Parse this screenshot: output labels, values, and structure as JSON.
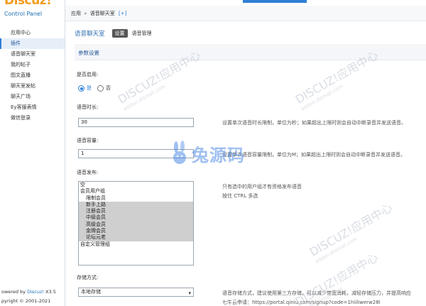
{
  "sidebar": {
    "brand": "Discuz!",
    "subtitle": "Control Panel",
    "items": [
      {
        "label": "应用中心"
      },
      {
        "label": "插件"
      },
      {
        "label": "语音聊天室"
      },
      {
        "label": "我的帖子"
      },
      {
        "label": "图文直播"
      },
      {
        "label": "聊天室发帖"
      },
      {
        "label": "聊天广场"
      },
      {
        "label": "Ey客服表情"
      },
      {
        "label": "微信登录"
      }
    ],
    "footer_line1_prefix": "owered by ",
    "footer_brand": "Discuz!",
    "footer_version": " X3.5",
    "footer_line2": "pyright © 2001-2021"
  },
  "breadcrumb": {
    "part1": "应用",
    "sep": "»",
    "part2": "语音聊天室",
    "plus": "[+]"
  },
  "header": {
    "plugin_title": "语音聊天室",
    "tab_settings": "设置",
    "tab_manage": "语音管理"
  },
  "section": {
    "title": "参数设置"
  },
  "form": {
    "enable_label": "是否启用:",
    "enable_yes": "是",
    "enable_no": "否",
    "duration_label": "语音时长:",
    "duration_value": "30",
    "duration_hint": "设置单次语音时长限制，单位为秒；如果超出上限时则会自动中断录音并发送语音。",
    "capacity_label": "语音容量:",
    "capacity_value": "1",
    "capacity_hint": "设置单次语音容量限制，单位为M；如果超出上限时则会自动中断录音并发送语音。",
    "publish_label": "语音发布:",
    "publish_hint1": "只有选中的用户组才有资格发布语音",
    "publish_hint2": "按住 CTRL 多选",
    "publish_options": [
      {
        "label": "空",
        "indent": false,
        "selected": false
      },
      {
        "label": "会员用户组",
        "indent": false,
        "selected": false
      },
      {
        "label": "限制会员",
        "indent": true,
        "selected": false
      },
      {
        "label": "新手上路",
        "indent": true,
        "selected": true
      },
      {
        "label": "注册会员",
        "indent": true,
        "selected": true
      },
      {
        "label": "中级会员",
        "indent": true,
        "selected": true
      },
      {
        "label": "高级会员",
        "indent": true,
        "selected": true
      },
      {
        "label": "金牌会员",
        "indent": true,
        "selected": true
      },
      {
        "label": "论坛元老",
        "indent": true,
        "selected": true
      },
      {
        "label": "自定义管理组",
        "indent": false,
        "selected": false
      }
    ],
    "storage_label": "存储方式:",
    "storage_value": "本地存储",
    "storage_hint1": "语音存储方式，建议使用第三方存储，可以减少带宽消耗，减轻存储压力，并提高响应",
    "storage_hint2": "七牛云申请：https://portal.qiniu.com/signup?code=1hiiliwerw28l"
  },
  "watermark": {
    "text": "DISCUZ!应用中心",
    "sub": "addon.dismall.com",
    "center": "兔源码"
  },
  "colors": {
    "accent": "#2f7fd6",
    "brand_orange": "#f29c1f"
  }
}
